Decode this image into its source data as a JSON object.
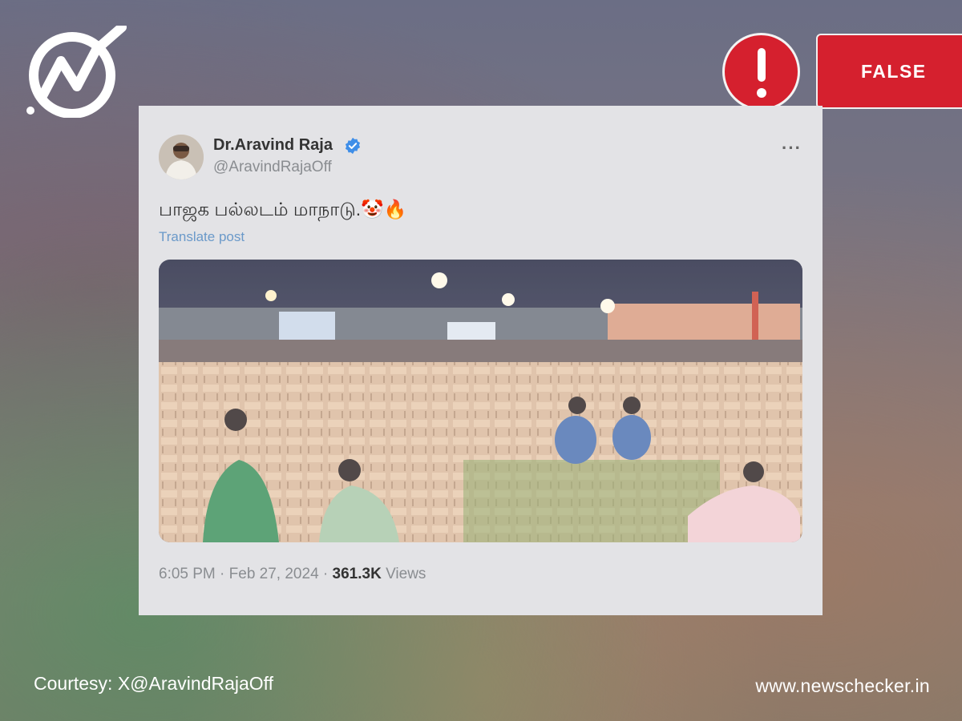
{
  "badge": {
    "label": "FALSE"
  },
  "tweet": {
    "author_name": "Dr.Aravind Raja",
    "handle": "@AravindRajaOff",
    "text": "பாஜக பல்லடம் மாநாடு.🤡🔥",
    "translate": "Translate post",
    "time": "6:05 PM",
    "date": "Feb 27, 2024",
    "views_count": "361.3K",
    "views_label": "Views",
    "media_description": "Night photo of a rally ground with rows of mostly empty plastic chairs and a few seated attendees"
  },
  "footer": {
    "courtesy": "Courtesy: X@AravindRajaOff",
    "site": "www.newschecker.in"
  },
  "colors": {
    "alert_red": "#d5202e",
    "link_blue": "#6a99c9",
    "verified_blue": "#3f8ee8"
  }
}
